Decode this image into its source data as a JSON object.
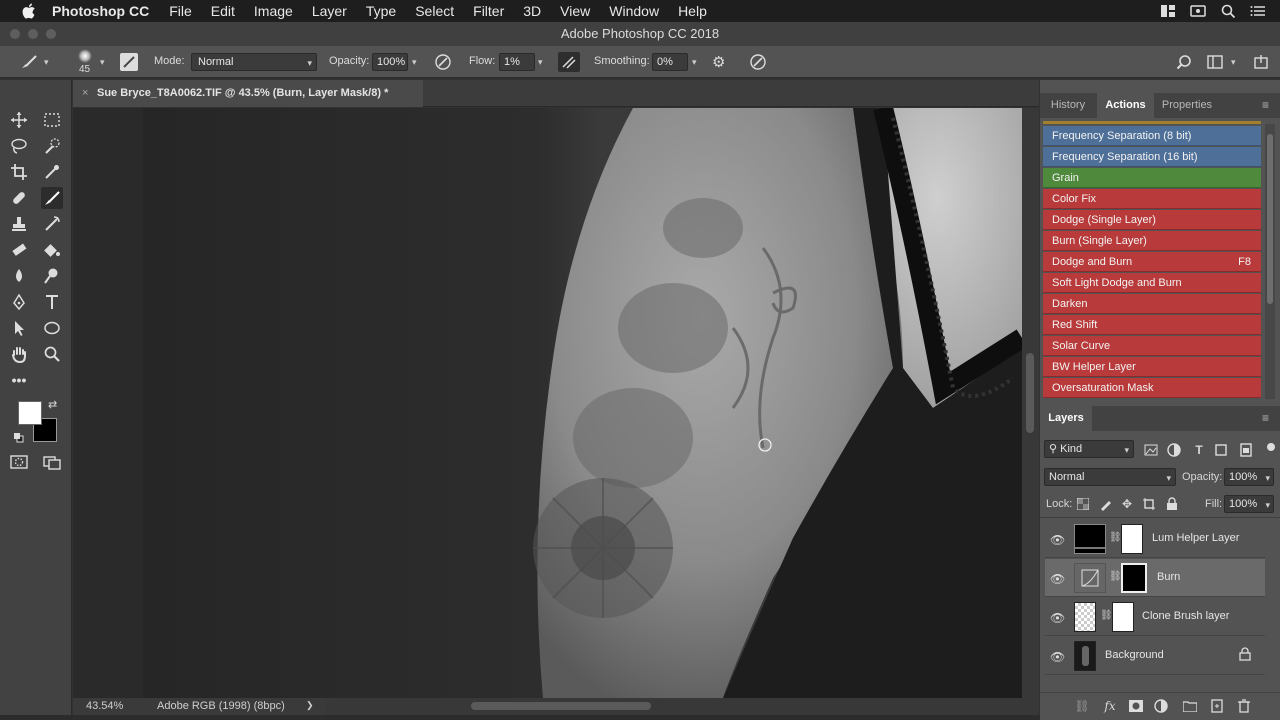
{
  "menubar": {
    "app_name": "Photoshop CC",
    "items": [
      "File",
      "Edit",
      "Image",
      "Layer",
      "Type",
      "Select",
      "Filter",
      "3D",
      "View",
      "Window",
      "Help"
    ]
  },
  "window": {
    "title": "Adobe Photoshop CC 2018"
  },
  "options": {
    "brush_size": "45",
    "mode_label": "Mode:",
    "mode_value": "Normal",
    "opacity_label": "Opacity:",
    "opacity_value": "100%",
    "flow_label": "Flow:",
    "flow_value": "1%",
    "smoothing_label": "Smoothing:",
    "smoothing_value": "0%"
  },
  "document": {
    "tab_title": "Sue Bryce_T8A0062.TIF @ 43.5% (Burn, Layer Mask/8) *",
    "close": "×"
  },
  "status": {
    "zoom": "43.54%",
    "profile": "Adobe RGB (1998) (8bpc)",
    "arrow": "❯"
  },
  "panels": {
    "top_tabs": [
      "History",
      "Actions",
      "Properties"
    ],
    "actions": [
      {
        "label": "Frequency Separation (8 bit)",
        "key": "",
        "color": "#4e6f97"
      },
      {
        "label": "Frequency Separation (16 bit)",
        "key": "",
        "color": "#4e6f97"
      },
      {
        "label": "Grain",
        "key": "",
        "color": "#4f8a3c"
      },
      {
        "label": "Color Fix",
        "key": "",
        "color": "#b83a3a"
      },
      {
        "label": "Dodge (Single Layer)",
        "key": "",
        "color": "#b83a3a"
      },
      {
        "label": "Burn (Single Layer)",
        "key": "",
        "color": "#b83a3a"
      },
      {
        "label": "Dodge and Burn",
        "key": "F8",
        "color": "#b83a3a"
      },
      {
        "label": "Soft Light Dodge and Burn",
        "key": "",
        "color": "#b83a3a"
      },
      {
        "label": "Darken",
        "key": "",
        "color": "#b83a3a"
      },
      {
        "label": "Red Shift",
        "key": "",
        "color": "#b83a3a"
      },
      {
        "label": "Solar Curve",
        "key": "",
        "color": "#b83a3a"
      },
      {
        "label": "BW Helper Layer",
        "key": "",
        "color": "#b83a3a"
      },
      {
        "label": "Oversaturation Mask",
        "key": "",
        "color": "#b83a3a"
      }
    ],
    "layers_tab": "Layers",
    "kind_label": "Kind",
    "blend_mode": "Normal",
    "opacity_label": "Opacity:",
    "opacity_value": "100%",
    "lock_label": "Lock:",
    "fill_label": "Fill:",
    "fill_value": "100%",
    "layers": [
      {
        "name": "Lum Helper Layer",
        "selected": false
      },
      {
        "name": "Burn",
        "selected": true
      },
      {
        "name": "Clone Brush layer",
        "selected": false
      },
      {
        "name": "Background",
        "selected": false
      }
    ]
  },
  "colors": {
    "foreground": "#ffffff",
    "background": "#000000"
  }
}
